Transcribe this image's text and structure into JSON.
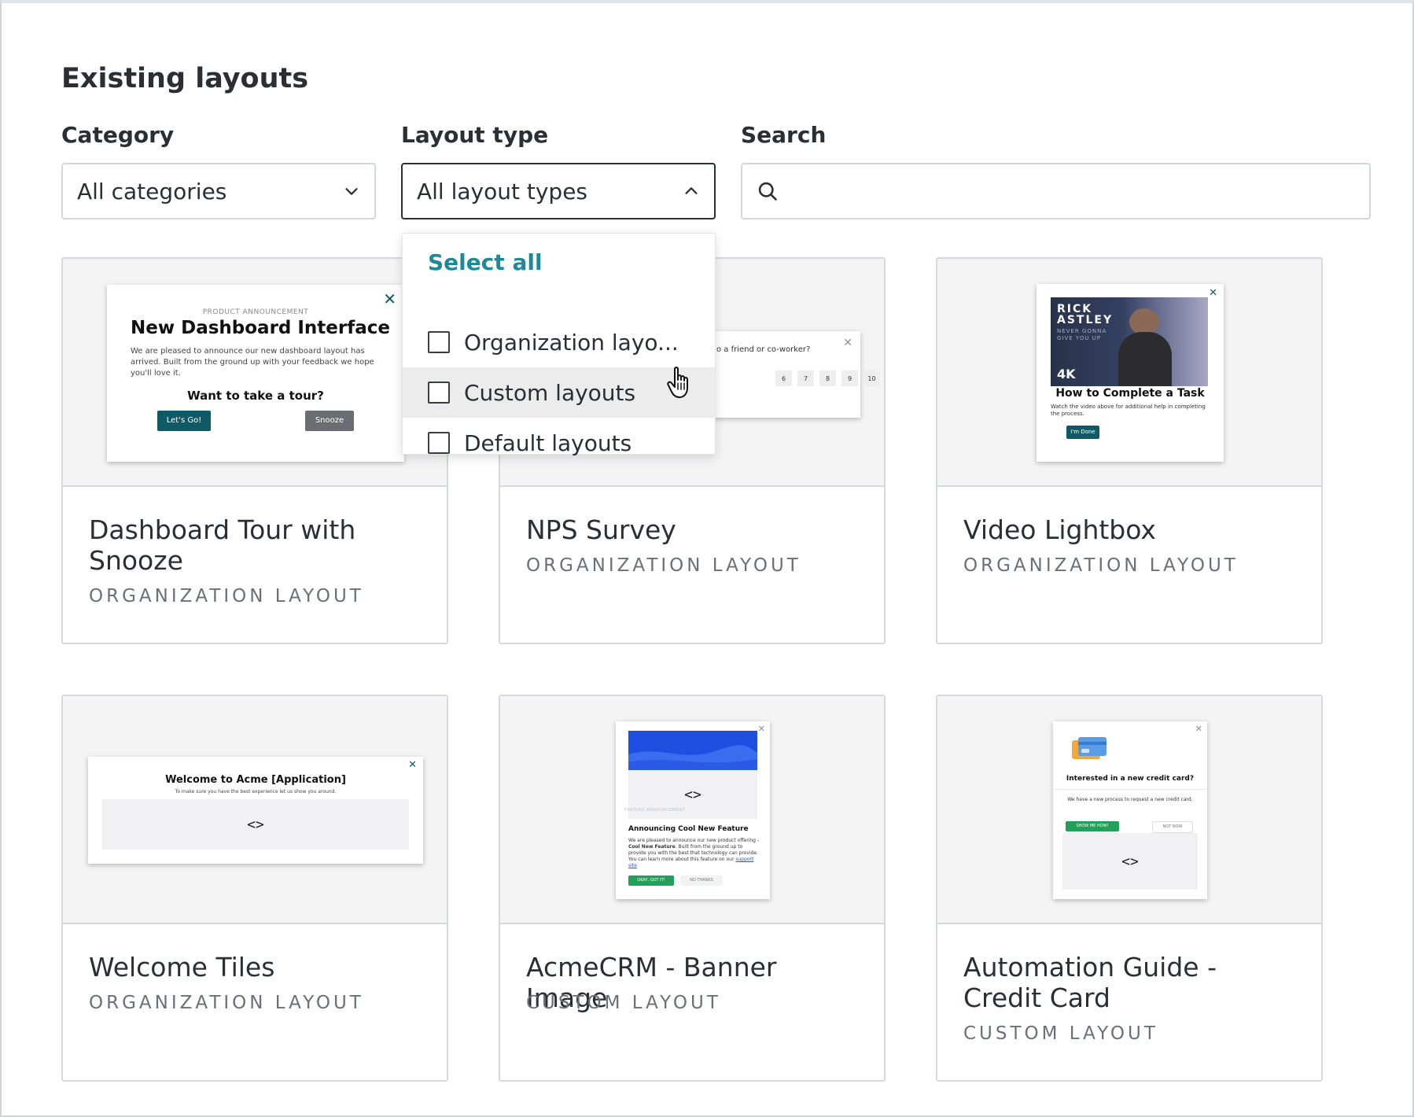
{
  "page": {
    "title": "Existing layouts"
  },
  "filters": {
    "category": {
      "label": "Category",
      "value": "All categories"
    },
    "layout_type": {
      "label": "Layout type",
      "value": "All layout types"
    },
    "search": {
      "label": "Search",
      "value": "",
      "placeholder": ""
    }
  },
  "dropdown": {
    "select_all": "Select all",
    "options": [
      {
        "label": "Organization layo...",
        "checked": false
      },
      {
        "label": "Custom layouts",
        "checked": false
      },
      {
        "label": "Default layouts",
        "checked": false
      }
    ]
  },
  "cards": [
    {
      "name": "Dashboard Tour with Snooze",
      "kind": "ORGANIZATION LAYOUT",
      "preview": {
        "eyebrow": "PRODUCT ANNOUNCEMENT",
        "heading": "New Dashboard Interface",
        "body": "We are pleased to announce our new dashboard layout has arrived. Built from the ground up with your feedback we hope you'll love it.",
        "question": "Want to take a tour?",
        "primary": "Let's Go!",
        "secondary": "Snooze"
      }
    },
    {
      "name": "NPS Survey",
      "kind": "ORGANIZATION LAYOUT",
      "preview": {
        "question": "o a friend or co-worker?",
        "scale": [
          "6",
          "7",
          "8",
          "9",
          "10"
        ]
      }
    },
    {
      "name": "Video Lightbox",
      "kind": "ORGANIZATION LAYOUT",
      "preview": {
        "video_title_1": "RICK",
        "video_title_2": "ASTLEY",
        "video_sub_1": "NEVER GONNA",
        "video_sub_2": "GIVE YOU UP",
        "badge": "4K",
        "heading": "How to Complete a Task",
        "body": "Watch the video above for additional help in completing the process.",
        "button": "I'm Done"
      }
    },
    {
      "name": "Welcome Tiles",
      "kind": "ORGANIZATION LAYOUT",
      "preview": {
        "heading": "Welcome to Acme [Application]",
        "sub": "To make sure you have the best experience let us show you around.",
        "code": "<>"
      }
    },
    {
      "name": "AcmeCRM - Banner Image",
      "kind": "CUSTOM LAYOUT",
      "preview": {
        "code": "<>",
        "eyebrow": "FEATURE ANNOUNCEMENT",
        "heading": "Announcing Cool New Feature",
        "body_1": "We are pleased to announce our new product offering - ",
        "body_bold": "Cool New Feature",
        "body_2": ". Built from the ground up to provide you with the best that technology can provide. You can learn more about this feature on our ",
        "link": "support site",
        "primary": "OKAY, GOT IT!",
        "secondary": "NO THANKS"
      }
    },
    {
      "name": "Automation Guide - Credit Card",
      "kind": "CUSTOM LAYOUT",
      "preview": {
        "heading": "Interested in a new credit card?",
        "body": "We have a new process to request a new credit card.",
        "primary": "SHOW ME HOW!",
        "secondary": "NOT NOW",
        "code": "<>"
      }
    }
  ],
  "colors": {
    "accent": "#1e8a99",
    "teal_button": "#0e5a66",
    "green_button": "#22a05a",
    "banner_blue": "#1f4fe0"
  }
}
